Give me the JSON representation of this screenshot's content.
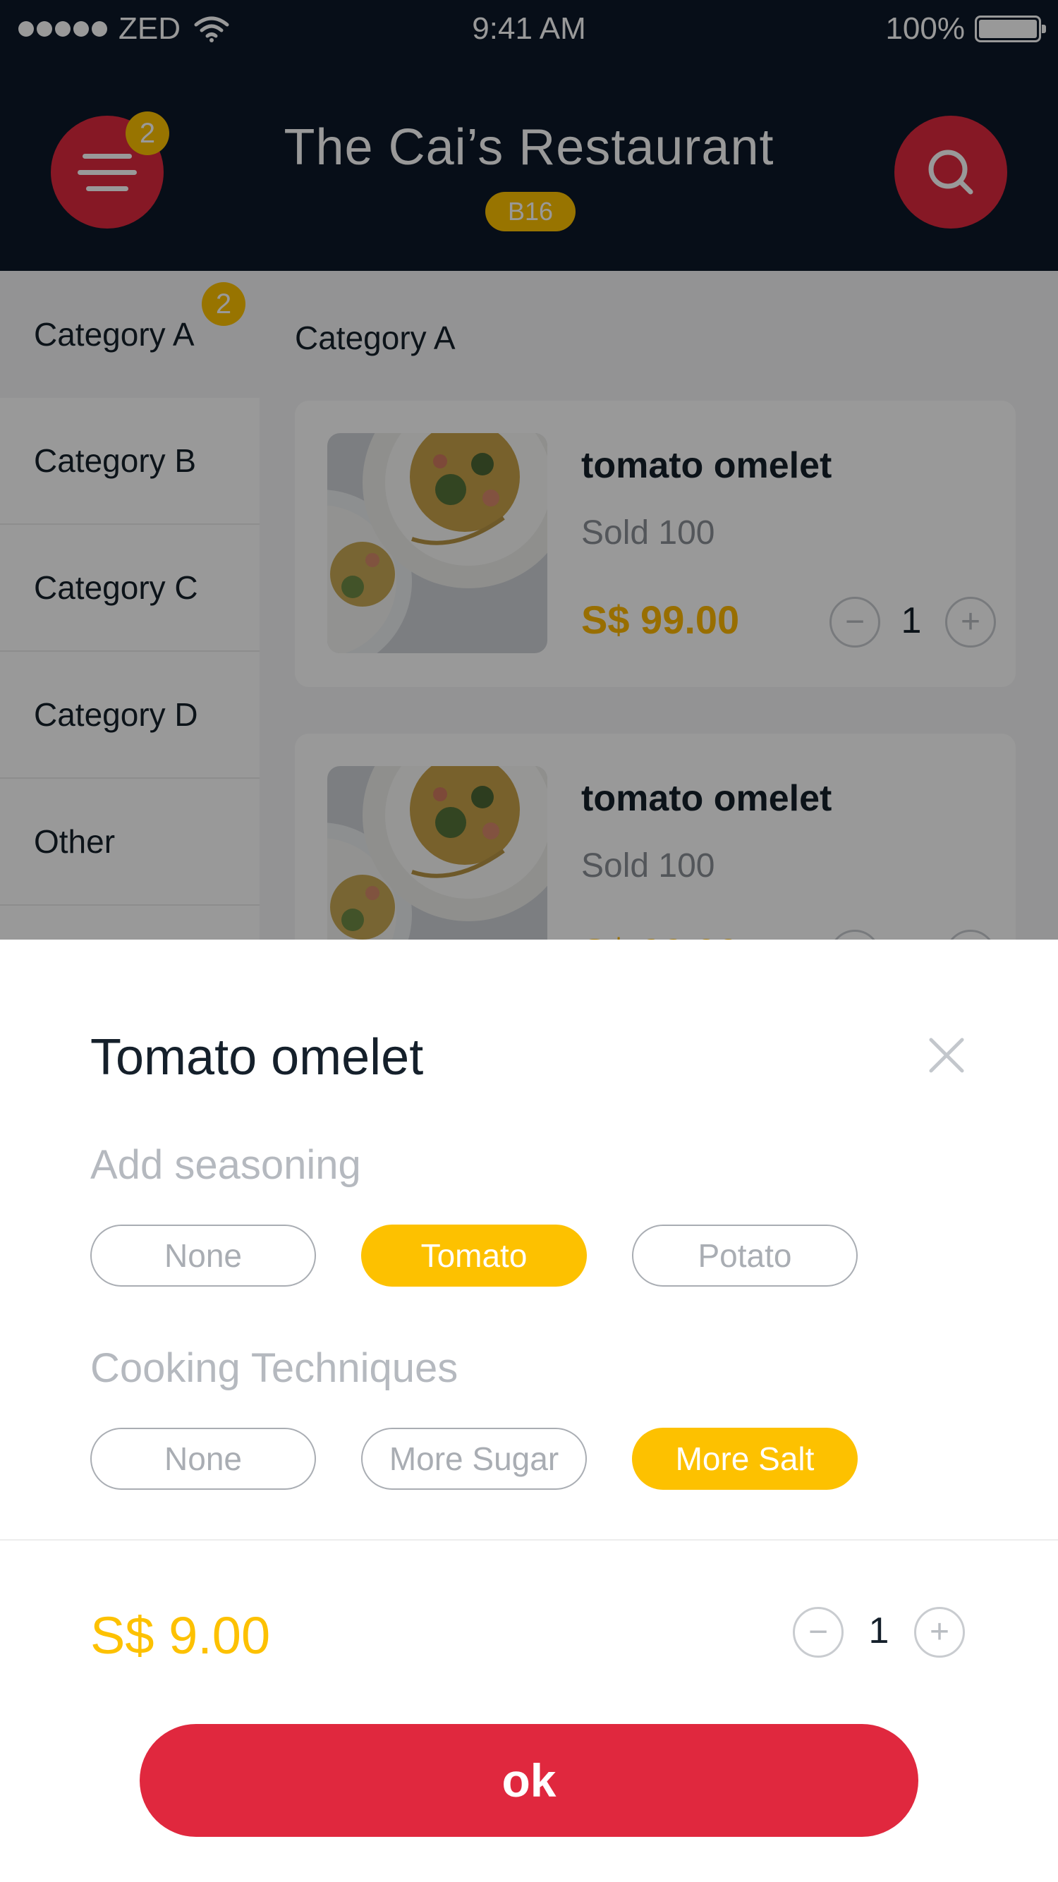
{
  "status_bar": {
    "carrier": "ZED",
    "time": "9:41 AM",
    "battery": "100%"
  },
  "header": {
    "title": "The Cai’s Restaurant",
    "table": "B16",
    "cart_count": "2"
  },
  "sidebar": {
    "items": [
      {
        "label": "Category A",
        "badge": "2"
      },
      {
        "label": "Category B"
      },
      {
        "label": "Category C"
      },
      {
        "label": "Category D"
      },
      {
        "label": "Other"
      }
    ]
  },
  "menu": {
    "section_title": "Category A",
    "dishes": [
      {
        "name": "tomato omelet",
        "sold": "Sold 100",
        "price": "S$ 99.00",
        "qty": "1"
      },
      {
        "name": "tomato omelet",
        "sold": "Sold 100",
        "price": "S$ 99.00",
        "qty": "1"
      }
    ]
  },
  "sheet": {
    "title": "Tomato omelet",
    "groups": [
      {
        "label": "Add seasoning",
        "options": [
          {
            "label": "None",
            "selected": false
          },
          {
            "label": "Tomato",
            "selected": true
          },
          {
            "label": "Potato",
            "selected": false
          }
        ]
      },
      {
        "label": "Cooking Techniques",
        "options": [
          {
            "label": "None",
            "selected": false
          },
          {
            "label": "More Sugar",
            "selected": false
          },
          {
            "label": "More Salt",
            "selected": true
          }
        ]
      }
    ],
    "total_price": "S$ 9.00",
    "qty": "1",
    "ok_label": "ok"
  },
  "colors": {
    "header_bg": "#0c1828",
    "accent_red": "#e0283e",
    "accent_yellow": "#fdc100"
  },
  "icons": [
    "menu-icon",
    "search-icon",
    "close-icon",
    "minus-icon",
    "plus-icon",
    "wifi-icon",
    "battery-icon"
  ]
}
